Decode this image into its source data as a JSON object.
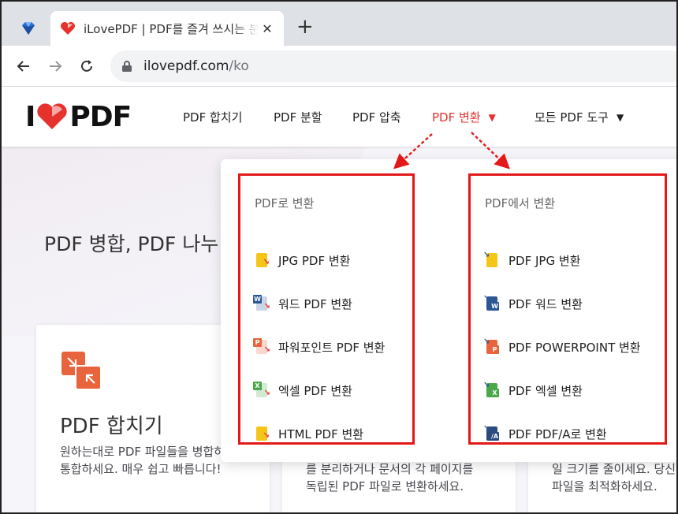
{
  "browser": {
    "tab_title": "iLovePDF | PDF를 즐겨 쓰시는 분",
    "close_glyph": "✕",
    "new_tab_glyph": "+",
    "url_host": "ilovepdf.com",
    "url_path": "/ko"
  },
  "site": {
    "logo_left": "I",
    "logo_right": "PDF",
    "nav": [
      {
        "label": "PDF 합치기"
      },
      {
        "label": "PDF 분할"
      },
      {
        "label": "PDF 압축"
      },
      {
        "label": "PDF 변환"
      },
      {
        "label": "모든 PDF 도구"
      }
    ],
    "caret_glyph": "▼",
    "hero_title": "PDF 병합, PDF 나누",
    "accent": "#e5322d"
  },
  "dropdown": {
    "to_pdf": {
      "heading": "PDF로 변환",
      "items": [
        {
          "label": "JPG PDF 변환",
          "icon": "jpg-to-pdf-icon",
          "badge": "",
          "color": "#f5c518"
        },
        {
          "label": "워드 PDF 변환",
          "icon": "word-to-pdf-icon",
          "badge": "W",
          "color": "#2b5797"
        },
        {
          "label": "파워포인트 PDF 변환",
          "icon": "powerpoint-to-pdf-icon",
          "badge": "P",
          "color": "#e8643c"
        },
        {
          "label": "엑셀 PDF 변환",
          "icon": "excel-to-pdf-icon",
          "badge": "X",
          "color": "#4aa74a"
        },
        {
          "label": "HTML PDF 변환",
          "icon": "html-to-pdf-icon",
          "badge": "",
          "color": "#f5c518"
        }
      ]
    },
    "from_pdf": {
      "heading": "PDF에서 변환",
      "items": [
        {
          "label": "PDF JPG 변환",
          "icon": "pdf-to-jpg-icon",
          "badge": "",
          "color": "#f5c518"
        },
        {
          "label": "PDF 워드 변환",
          "icon": "pdf-to-word-icon",
          "badge": "W",
          "color": "#2b5797"
        },
        {
          "label": "PDF POWERPOINT 변환",
          "icon": "pdf-to-powerpoint-icon",
          "badge": "P",
          "color": "#e8643c"
        },
        {
          "label": "PDF 엑셀 변환",
          "icon": "pdf-to-excel-icon",
          "badge": "X",
          "color": "#4aa74a"
        },
        {
          "label": "PDF PDF/A로 변환",
          "icon": "pdf-to-pdfa-icon",
          "badge": "/A",
          "color": "#2b4a7e"
        }
      ]
    }
  },
  "cards": [
    {
      "title": "PDF 합치기",
      "desc": "원하는대로 PDF 파일들을 병합하고 통합하세요. 매우 쉽고 빠릅니다!"
    },
    {
      "desc_line1": "를 분리하거나 문서의 각 페이지를",
      "desc_line2": "독립된 PDF 파일로 변환하세요."
    },
    {
      "desc_line1": "일 크기를 줄이세요. 당신",
      "desc_line2": "파일을 최적화하세요."
    }
  ],
  "annotation_color": "#e31919"
}
